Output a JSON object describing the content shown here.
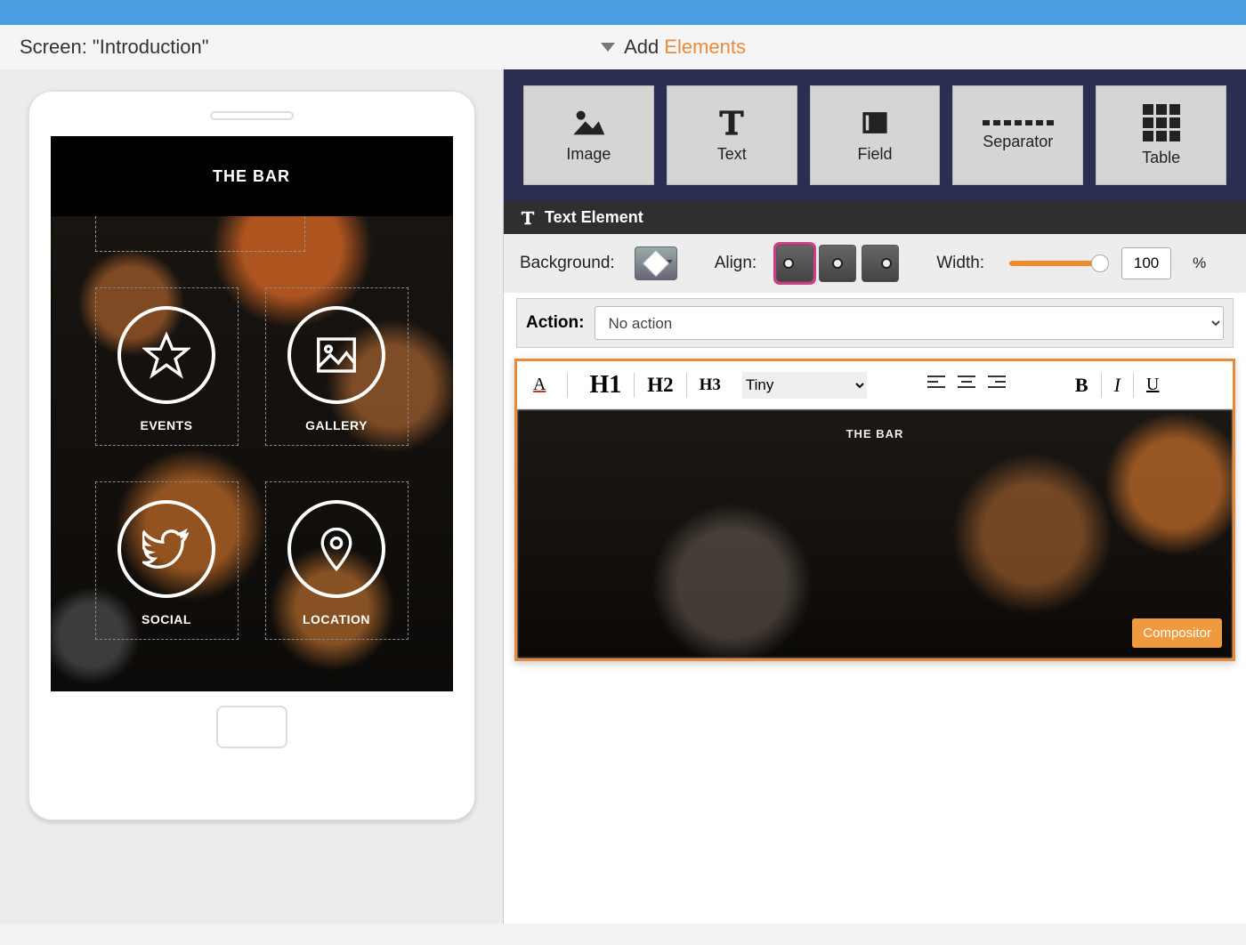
{
  "header": {
    "screen_label": "Screen: \"Introduction\"",
    "add_label": "Add",
    "elements_link": "Elements"
  },
  "preview": {
    "title": "THE BAR",
    "tiles": [
      {
        "label": "EVENTS",
        "icon": "star"
      },
      {
        "label": "GALLERY",
        "icon": "picture"
      },
      {
        "label": "SOCIAL",
        "icon": "twitter"
      },
      {
        "label": "LOCATION",
        "icon": "pin"
      }
    ]
  },
  "elements_palette": [
    {
      "label": "Image",
      "kind": "image"
    },
    {
      "label": "Text",
      "kind": "text"
    },
    {
      "label": "Field",
      "kind": "field"
    },
    {
      "label": "Separator",
      "kind": "separator"
    },
    {
      "label": "Table",
      "kind": "table"
    }
  ],
  "section": {
    "title": "Text Element"
  },
  "controls": {
    "background_label": "Background:",
    "align_label": "Align:",
    "align_selected": "left",
    "width_label": "Width:",
    "width_value": "100",
    "width_unit": "%"
  },
  "action": {
    "label": "Action:",
    "selected": "No action"
  },
  "editor": {
    "headings": [
      "H1",
      "H2",
      "H3"
    ],
    "font": "Tiny",
    "style_buttons": {
      "bold": "B",
      "italic": "I",
      "underline": "U"
    },
    "canvas_text": "THE BAR",
    "compositor_button": "Compositor"
  }
}
